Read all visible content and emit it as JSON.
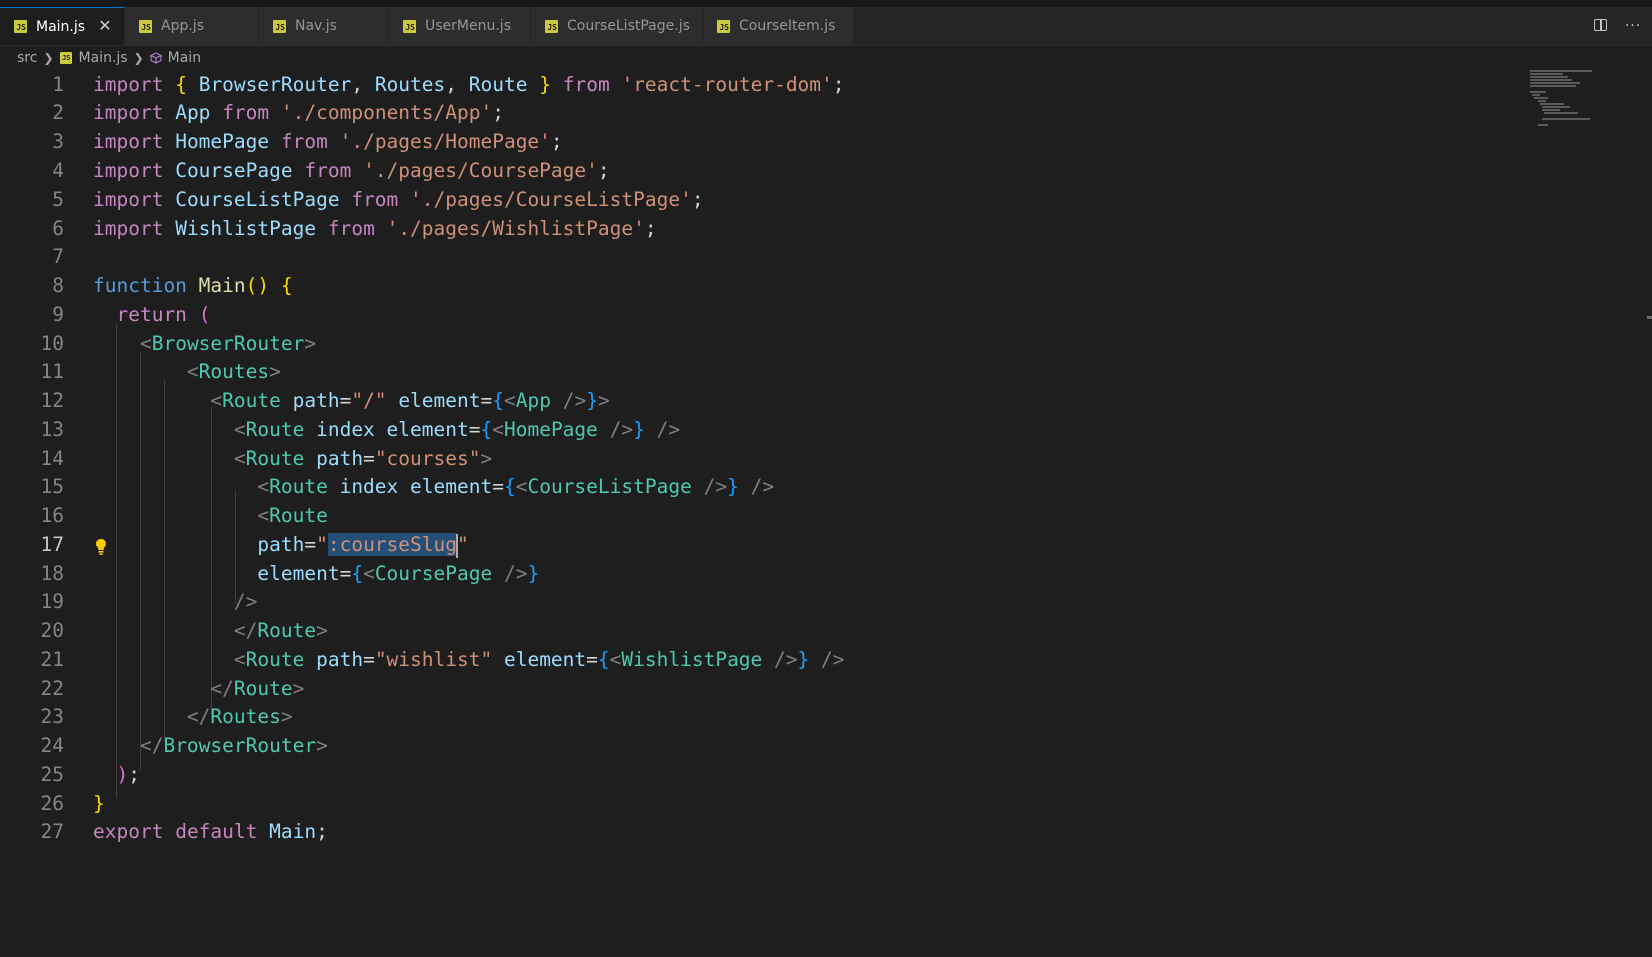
{
  "tabs": [
    {
      "label": "Main.js",
      "active": true
    },
    {
      "label": "App.js"
    },
    {
      "label": "Nav.js"
    },
    {
      "label": "UserMenu.js"
    },
    {
      "label": "CourseListPage.js"
    },
    {
      "label": "CourseItem.js"
    }
  ],
  "tab_icon_text": "JS",
  "close_glyph": "✕",
  "breadcrumb": {
    "folder": "src",
    "file": "Main.js",
    "symbol": "Main"
  },
  "more_glyph": "···",
  "current_line": 17,
  "lines": [
    {
      "n": "1",
      "code": "import { BrowserRouter, Routes, Route } from 'react-router-dom';"
    },
    {
      "n": "2",
      "code": "import App from './components/App';"
    },
    {
      "n": "3",
      "code": "import HomePage from './pages/HomePage';"
    },
    {
      "n": "4",
      "code": "import CoursePage from './pages/CoursePage';"
    },
    {
      "n": "5",
      "code": "import CourseListPage from './pages/CourseListPage';"
    },
    {
      "n": "6",
      "code": "import WishlistPage from './pages/WishlistPage';"
    },
    {
      "n": "7",
      "code": ""
    },
    {
      "n": "8",
      "code": "function Main() {"
    },
    {
      "n": "9",
      "code": "  return ("
    },
    {
      "n": "10",
      "code": "    <BrowserRouter>"
    },
    {
      "n": "11",
      "code": "        <Routes>"
    },
    {
      "n": "12",
      "code": "          <Route path=\"/\" element={<App />}>"
    },
    {
      "n": "13",
      "code": "            <Route index element={<HomePage />} />"
    },
    {
      "n": "14",
      "code": "            <Route path=\"courses\">"
    },
    {
      "n": "15",
      "code": "              <Route index element={<CourseListPage />} />"
    },
    {
      "n": "16",
      "code": "              <Route"
    },
    {
      "n": "17",
      "code": "              path=\":courseSlug\""
    },
    {
      "n": "18",
      "code": "              element={<CoursePage />}"
    },
    {
      "n": "19",
      "code": "            />"
    },
    {
      "n": "20",
      "code": "            </Route>"
    },
    {
      "n": "21",
      "code": "            <Route path=\"wishlist\" element={<WishlistPage />} />"
    },
    {
      "n": "22",
      "code": "          </Route>"
    },
    {
      "n": "23",
      "code": "        </Routes>"
    },
    {
      "n": "24",
      "code": "    </BrowserRouter>"
    },
    {
      "n": "25",
      "code": "  );"
    },
    {
      "n": "26",
      "code": "}"
    },
    {
      "n": "27",
      "code": "export default Main;"
    }
  ],
  "selection": {
    "line": 17,
    "text": ":courseSlug"
  },
  "colors": {
    "editor_bg": "#1e1e1e",
    "keyword": "#c586c0",
    "storage": "#569cd6",
    "function": "#dcdcaa",
    "variable": "#9cdcfe",
    "string": "#ce9178",
    "tag": "#4ec9b0",
    "selection": "#264f78"
  }
}
